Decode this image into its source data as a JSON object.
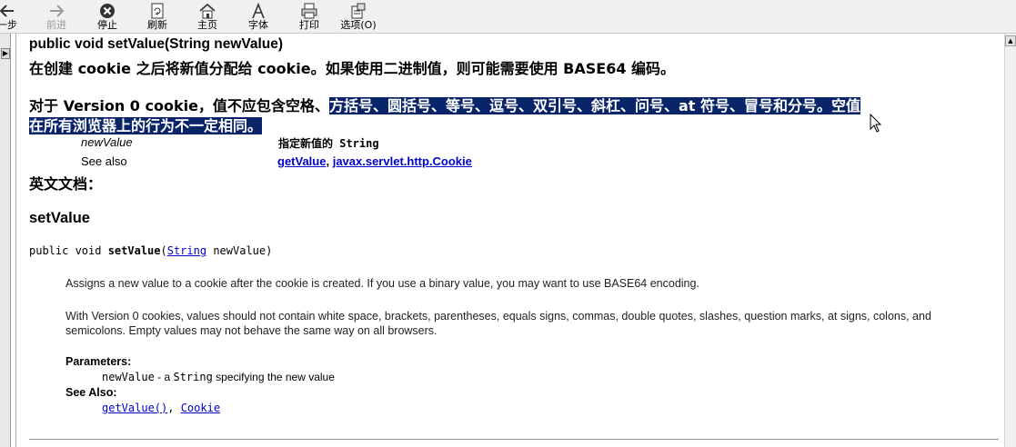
{
  "toolbar": {
    "back_label": "一步",
    "forward_label": "前进",
    "stop_label": "停止",
    "refresh_label": "刷新",
    "home_label": "主页",
    "font_label": "字体",
    "print_label": "打印",
    "options_label": "选项(O)"
  },
  "cn_doc": {
    "signature": "public void setValue(String newValue)",
    "desc_line1": "在创建 cookie 之后将新值分配给 cookie。如果使用二进制值，则可能需要使用 BASE64 编码。",
    "desc2_normal": "对于 Version 0 cookie，值不应包含空格、",
    "desc2_selected_a": "方括号、圆括号、等号、逗号、双引号、斜杠、问号、at 符号、冒号和分号。空值",
    "desc2_selected_b": "在所有浏览器上的行为不一定相同。",
    "param_name": "newValue",
    "param_desc": "指定新值的 String",
    "see_also_label": "See also",
    "see_link1": "getValue",
    "see_sep": ", ",
    "see_link2": "javax.servlet.http.Cookie",
    "en_doc_label": "英文文档："
  },
  "en_doc": {
    "method_heading": "setValue",
    "sig_prefix": "public void ",
    "sig_method": "setValue",
    "sig_open": "(",
    "sig_type": "String",
    "sig_rest": " newValue)",
    "para1": "Assigns a new value to a cookie after the cookie is created. If you use a binary value, you may want to use BASE64 encoding.",
    "para2_line1": "With Version 0 cookies, values should not contain white space, brackets, parentheses, equals signs, commas, double quotes, slashes, question marks, at signs, colons, and",
    "para2_line2": "semicolons. Empty values may not behave the same way on all browsers.",
    "parameters_label": "Parameters:",
    "param_name": "newValue",
    "param_desc_a": " - a ",
    "param_type": "String",
    "param_desc_b": " specifying the new value",
    "see_also_label": "See Also:",
    "see_link1": "getValue()",
    "see_sep": ", ",
    "see_link2": "Cookie"
  },
  "colors": {
    "selection_bg": "#0a246a",
    "link": "#0000cc"
  }
}
